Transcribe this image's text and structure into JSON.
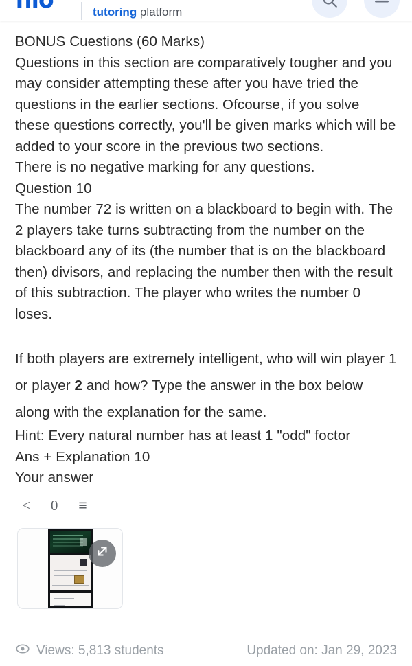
{
  "header": {
    "logo_text": "filo",
    "tagline_highlight": "tutoring",
    "tagline_rest": " platform",
    "search_icon": "search-icon",
    "menu_icon": "hamburger-menu-icon",
    "brand_color": "#0d5bd4",
    "accent_color": "#1565d8"
  },
  "question": {
    "section_title": "BONUS Cuestions (60 Marks)",
    "intro": "Questions in this section are comparatively tougher and you may consider attempting these after you have tried the questions in the earlier sections. Ofcourse, if you solve these questions correctly, you'll be given marks which will be added to your score in the previous two sections.",
    "no_negative": "There is no negative marking for any questions.",
    "question_label": "Question 10",
    "body_part1": "The number 72 is written on a blackboard to begin with. The 2 players take turns subtracting from the number on the blackboard any of its (the number that is on the blackboard then) divisors, and replacing the number then with the result of this subtraction. The player who writes the number 0 loses.",
    "prompt_pre": "If both players are extremely intelligent, who will win player 1 or player ",
    "prompt_bold": "2",
    "prompt_post": " and how? Type the answer in the box below along with the explanation for the same.",
    "hint": "Hint: Every natural number has at least 1 \"odd\" foctor",
    "ans_label": "Ans + Explanation 10",
    "your_answer_label": "Your answer"
  },
  "editor_toolbar": {
    "back_symbol": "<",
    "count": "0",
    "lines_symbol": "≡"
  },
  "attachment": {
    "expand_icon": "expand-arrows-icon",
    "alt": "student-handwritten-solution-photo"
  },
  "footer": {
    "views_icon": "eye-icon",
    "views_text": "Views: 5,813 students",
    "updated_text": "Updated on: Jan 29, 2023"
  }
}
